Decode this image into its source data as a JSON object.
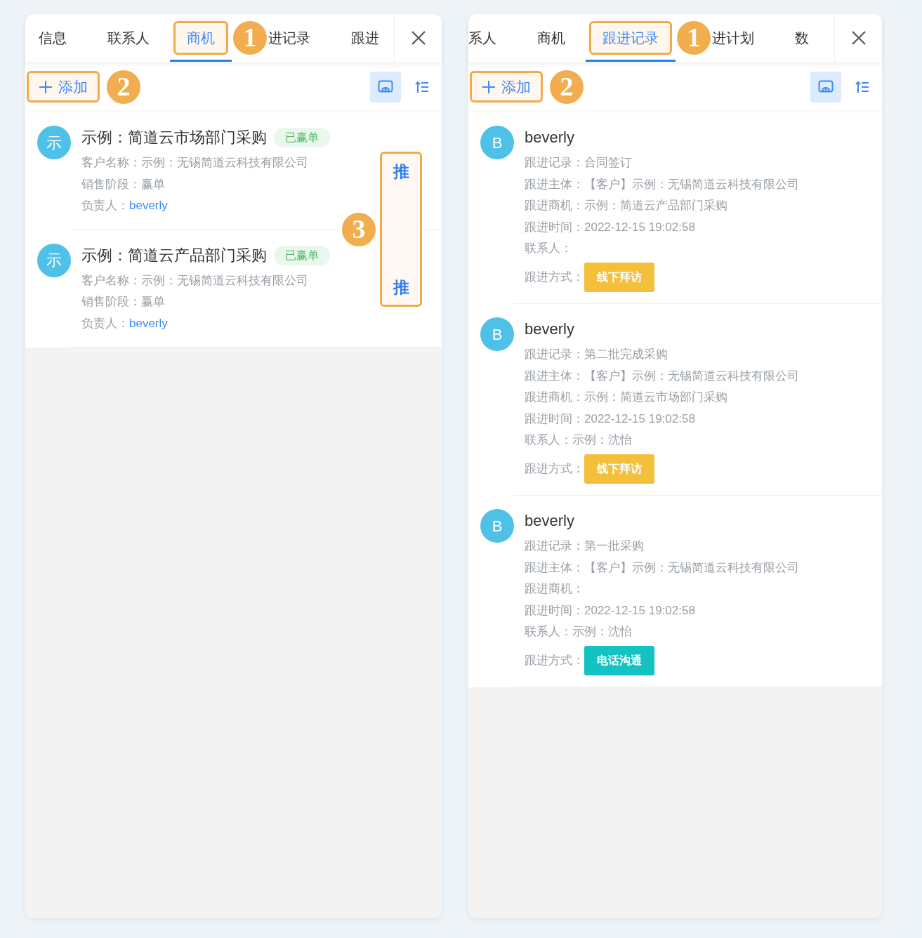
{
  "panels": [
    {
      "kind": "opportunity-list",
      "tabs": [
        {
          "label": "信息",
          "selected": false,
          "highlighted": false
        },
        {
          "label": "联系人",
          "selected": false,
          "highlighted": false
        },
        {
          "label": "商机",
          "selected": true,
          "highlighted": true
        },
        {
          "label": "进记录",
          "selected": false,
          "highlighted": false
        },
        {
          "label": "跟进",
          "selected": false,
          "highlighted": false
        }
      ],
      "tab_callout": "1",
      "add_button": {
        "label": "添加",
        "highlighted": true
      },
      "add_callout": "2",
      "items": [
        {
          "avatar": "示",
          "title": "示例：简道云市场部门采购",
          "tag": "已赢单",
          "fields": [
            {
              "kind": "text",
              "label": "客户名称：",
              "value": "示例：无锡简道云科技有限公司"
            },
            {
              "kind": "text",
              "label": "销售阶段：",
              "value": "赢单"
            },
            {
              "kind": "link",
              "label": "负责人：",
              "value": "beverly"
            }
          ]
        },
        {
          "avatar": "示",
          "title": "示例：简道云产品部门采购",
          "tag": "已赢单",
          "fields": [
            {
              "kind": "text",
              "label": "客户名称：",
              "value": "示例：无锡简道云科技有限公司"
            },
            {
              "kind": "text",
              "label": "销售阶段：",
              "value": "赢单"
            },
            {
              "kind": "link",
              "label": "负责人：",
              "value": "beverly"
            }
          ]
        }
      ],
      "push_column": {
        "labels": [
          "推",
          "推"
        ],
        "highlighted": true,
        "callout": "3"
      }
    },
    {
      "kind": "record-list",
      "tabs": [
        {
          "label": "系人",
          "selected": false,
          "highlighted": false
        },
        {
          "label": "商机",
          "selected": false,
          "highlighted": false
        },
        {
          "label": "跟进记录",
          "selected": true,
          "highlighted": true
        },
        {
          "label": "进计划",
          "selected": false,
          "highlighted": false
        },
        {
          "label": "数",
          "selected": false,
          "highlighted": false
        }
      ],
      "tab_callout": "1",
      "add_button": {
        "label": "添加",
        "highlighted": true
      },
      "add_callout": "2",
      "items": [
        {
          "avatar": "B",
          "title": "beverly",
          "fields": [
            {
              "kind": "text",
              "label": "跟进记录：",
              "value": "合同签订"
            },
            {
              "kind": "text",
              "label": "跟进主体：",
              "value": "【客户】示例：无锡简道云科技有限公司"
            },
            {
              "kind": "text",
              "label": "跟进商机：",
              "value": "示例：简道云产品部门采购"
            },
            {
              "kind": "text",
              "label": "跟进时间：",
              "value": "2022-12-15 19:02:58"
            },
            {
              "kind": "text",
              "label": "联系人："
            },
            {
              "kind": "tag",
              "label": "跟进方式：",
              "value": "线下拜访",
              "color": "#f4c03c"
            }
          ]
        },
        {
          "avatar": "B",
          "title": "beverly",
          "fields": [
            {
              "kind": "text",
              "label": "跟进记录：",
              "value": "第二批完成采购"
            },
            {
              "kind": "text",
              "label": "跟进主体：",
              "value": "【客户】示例：无锡简道云科技有限公司"
            },
            {
              "kind": "text",
              "label": "跟进商机：",
              "value": "示例：简道云市场部门采购"
            },
            {
              "kind": "text",
              "label": "跟进时间：",
              "value": "2022-12-15 19:02:58"
            },
            {
              "kind": "text",
              "label": "联系人：",
              "value": "示例：沈怡"
            },
            {
              "kind": "tag",
              "label": "跟进方式：",
              "value": "线下拜访",
              "color": "#f4c03c"
            }
          ]
        },
        {
          "avatar": "B",
          "title": "beverly",
          "fields": [
            {
              "kind": "text",
              "label": "跟进记录：",
              "value": "第一批采购"
            },
            {
              "kind": "text",
              "label": "跟进主体：",
              "value": "【客户】示例：无锡简道云科技有限公司"
            },
            {
              "kind": "text",
              "label": "跟进商机："
            },
            {
              "kind": "text",
              "label": "跟进时间：",
              "value": "2022-12-15 19:02:58"
            },
            {
              "kind": "text",
              "label": "联系人：",
              "value": "示例：沈怡"
            },
            {
              "kind": "tag",
              "label": "跟进方式：",
              "value": "电话沟通",
              "color": "#13c2c2"
            }
          ]
        }
      ]
    }
  ]
}
